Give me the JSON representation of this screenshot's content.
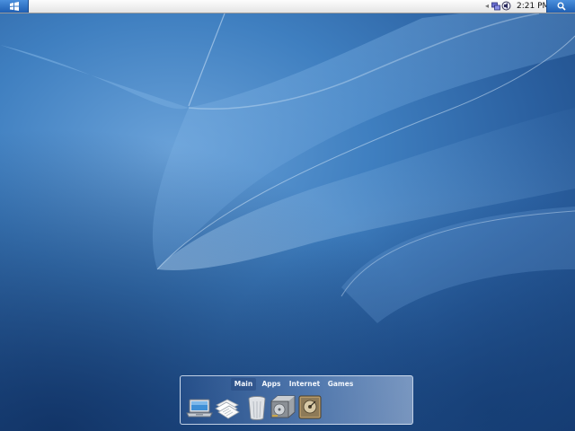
{
  "panel": {
    "start_icon": "start-menu-icon",
    "tray_icons": [
      "expand-tray-icon",
      "network-icon",
      "volume-icon"
    ],
    "tray_arrow": "◂",
    "clock": "2:21 PM",
    "search_icon": "search-icon"
  },
  "launcher": {
    "tabs": [
      {
        "label": "Main",
        "active": true
      },
      {
        "label": "Apps",
        "active": false
      },
      {
        "label": "Internet",
        "active": false
      },
      {
        "label": "Games",
        "active": false
      }
    ],
    "icons": [
      "laptop-icon",
      "documents-icon",
      "trash-icon",
      "hard-drive-icon",
      "media-drive-icon"
    ]
  },
  "colors": {
    "accent": "#2f72c6",
    "wallpaper_light": "#6aa2d9",
    "wallpaper_dark": "#173e75"
  }
}
